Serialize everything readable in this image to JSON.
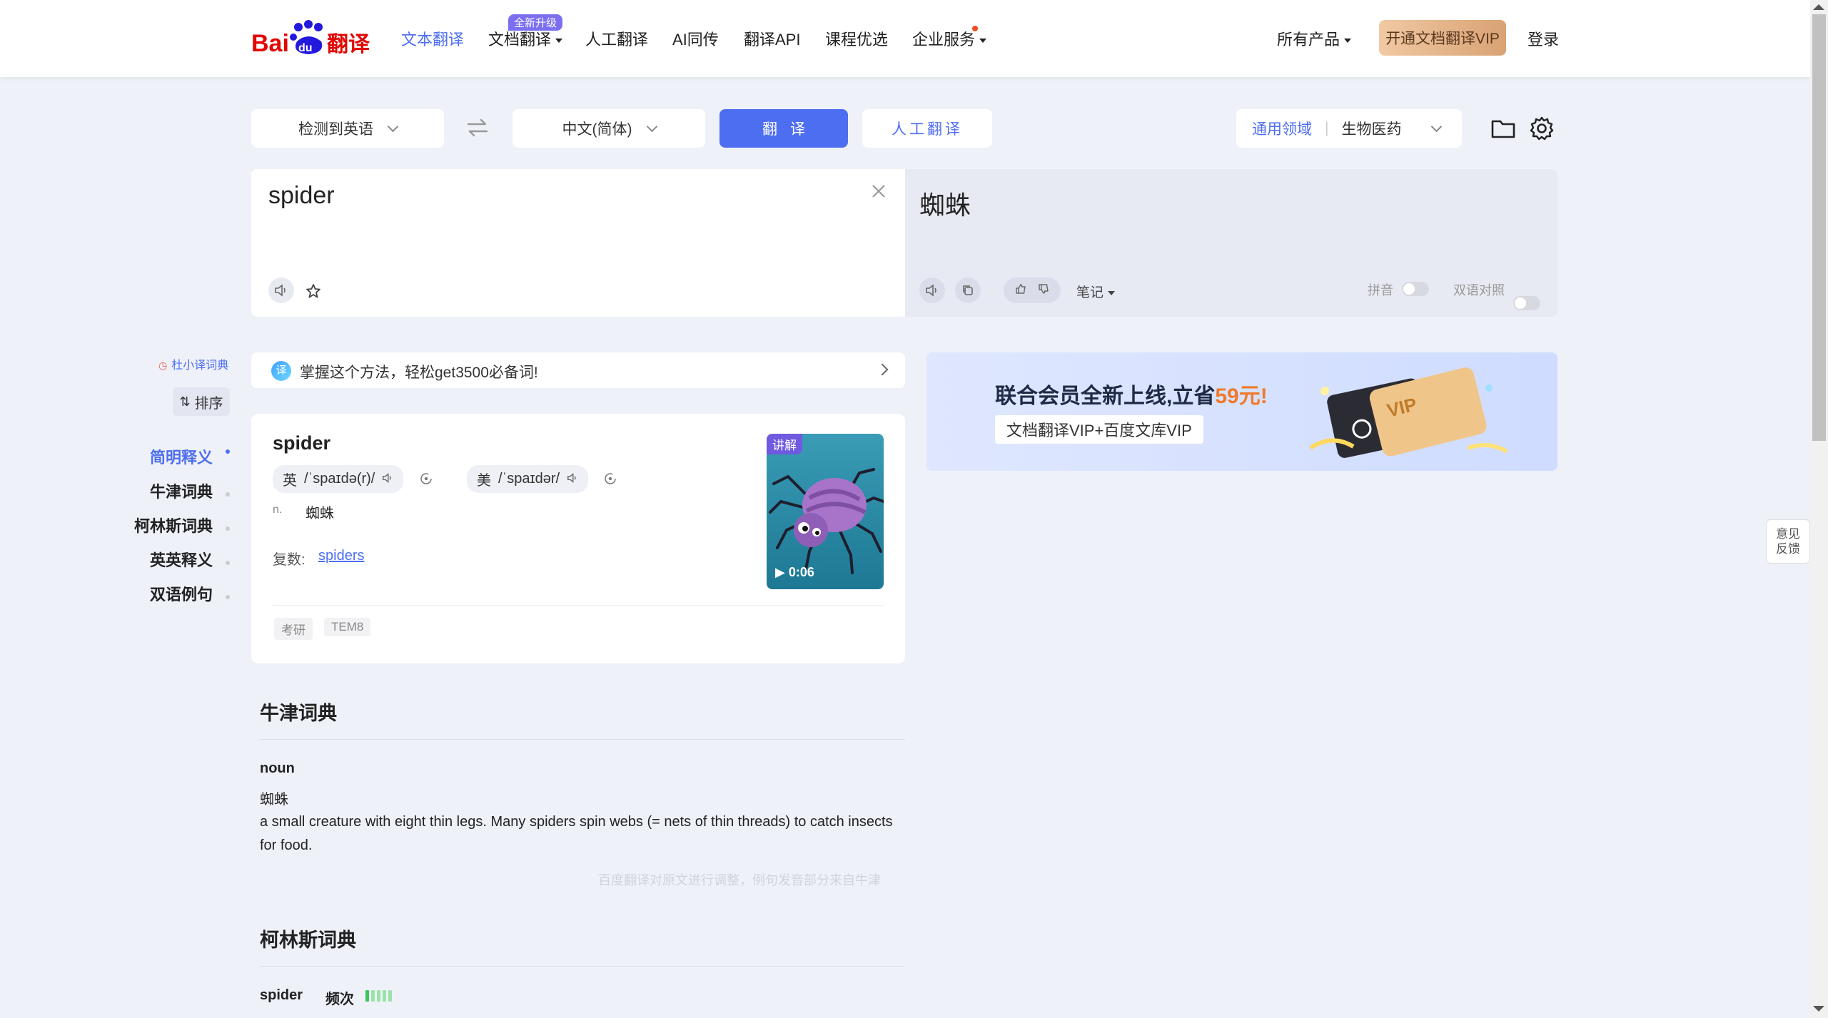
{
  "header": {
    "logo_text": "Bai du 翻译",
    "nav": [
      {
        "label": "文本翻译",
        "active": true
      },
      {
        "label": "文档翻译",
        "badge": "全新升级",
        "dropdown": true
      },
      {
        "label": "人工翻译"
      },
      {
        "label": "AI同传"
      },
      {
        "label": "翻译API"
      },
      {
        "label": "课程优选"
      },
      {
        "label": "企业服务",
        "dropdown": true,
        "dot": true
      }
    ],
    "all_products": "所有产品",
    "vip_button": "开通文档翻译VIP",
    "login": "登录"
  },
  "toolbar": {
    "source_lang": "检测到英语",
    "swap_icon": "swap-icon",
    "target_lang": "中文(简体)",
    "translate_button": "翻译",
    "human_translate_button": "人工翻译",
    "domain_label": "通用领域",
    "domain_value": "生物医药",
    "folder_icon": "folder-icon",
    "settings_icon": "gear-icon"
  },
  "input": {
    "text": "spider",
    "clear_icon": "close-icon",
    "speaker_icon": "speaker-icon",
    "star_icon": "star-icon"
  },
  "output": {
    "text": "蜘蛛",
    "notes_label": "笔记",
    "pinyin_label": "拼音",
    "bilingual_label": "双语对照"
  },
  "sidebar": {
    "dict_link": "杜小译词典",
    "sort_label": "排序",
    "items": [
      {
        "label": "简明释义",
        "active": true
      },
      {
        "label": "牛津词典"
      },
      {
        "label": "柯林斯词典"
      },
      {
        "label": "英英释义"
      },
      {
        "label": "双语例句"
      }
    ]
  },
  "promo_bar": {
    "text": "掌握这个方法，轻松get3500必备词!"
  },
  "word_card": {
    "word": "spider",
    "uk_label": "英",
    "uk_phonetic": "/ˈspaɪdə(r)/",
    "us_label": "美",
    "us_phonetic": "/ˈspaɪdər/",
    "pos": "n.",
    "meaning": "蜘蛛",
    "plural_label": "复数:",
    "plural_value": "spiders",
    "video_badge": "讲解",
    "video_duration": "0:06",
    "tags": [
      "考研",
      "TEM8"
    ]
  },
  "ad_banner": {
    "headline_prefix": "联合会员全新上线,立省",
    "headline_amount": "59元!",
    "subline": "文档翻译VIP+百度文库VIP",
    "card_text": "VIP"
  },
  "oxford": {
    "title": "牛津词典",
    "pos": "noun",
    "meaning_cn": "蜘蛛",
    "definition": "a small creature with eight thin legs. Many spiders spin webs (= nets of thin threads) to catch insects for food.",
    "note": "百度翻译对原文进行调整，例句发音部分来自牛津"
  },
  "collins": {
    "title": "柯林斯词典",
    "word": "spider",
    "freq_label": "频次",
    "frequency_bars_filled": 1,
    "frequency_bars_total": 5
  },
  "feedback": {
    "line1": "意见",
    "line2": "反馈"
  },
  "colors": {
    "accent": "#4e6ef2",
    "background": "#eef1f8",
    "freq_green": "#3cc45b"
  }
}
